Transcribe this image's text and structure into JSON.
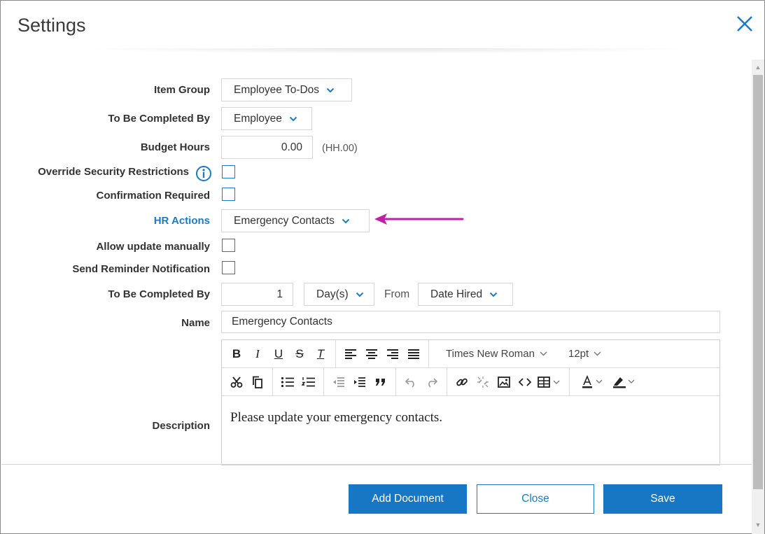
{
  "dialog": {
    "title": "Settings",
    "close_icon": "close-icon"
  },
  "form": {
    "item_group": {
      "label": "Item Group",
      "value": "Employee To-Dos"
    },
    "completed_by_person": {
      "label": "To Be Completed By",
      "value": "Employee"
    },
    "budget_hours": {
      "label": "Budget Hours",
      "value": "0.00",
      "hint": "(HH.00)"
    },
    "override_security": {
      "label": "Override Security Restrictions",
      "checked": false
    },
    "confirmation_required": {
      "label": "Confirmation Required",
      "checked": false
    },
    "hr_actions": {
      "label": "HR Actions",
      "value": "Emergency Contacts"
    },
    "allow_update_manually": {
      "label": "Allow update manually",
      "checked": false
    },
    "send_reminder": {
      "label": "Send Reminder Notification",
      "checked": false
    },
    "completed_by_time": {
      "label": "To Be Completed By",
      "amount": "1",
      "unit": "Day(s)",
      "from_label": "From",
      "from_value": "Date Hired"
    },
    "name": {
      "label": "Name",
      "value": "Emergency Contacts"
    },
    "description": {
      "label": "Description",
      "content": "Please update your emergency contacts."
    }
  },
  "editor_toolbar": {
    "font_family": "Times New Roman",
    "font_size": "12pt",
    "bold": "B",
    "italic": "I",
    "underline": "U",
    "strikethrough": "S",
    "clear_format": "T"
  },
  "buttons": {
    "add_document": "Add Document",
    "close": "Close",
    "save": "Save"
  },
  "colors": {
    "accent": "#1a7bc7",
    "primary_button": "#1877c5",
    "annotation_arrow": "#c21fa6"
  }
}
